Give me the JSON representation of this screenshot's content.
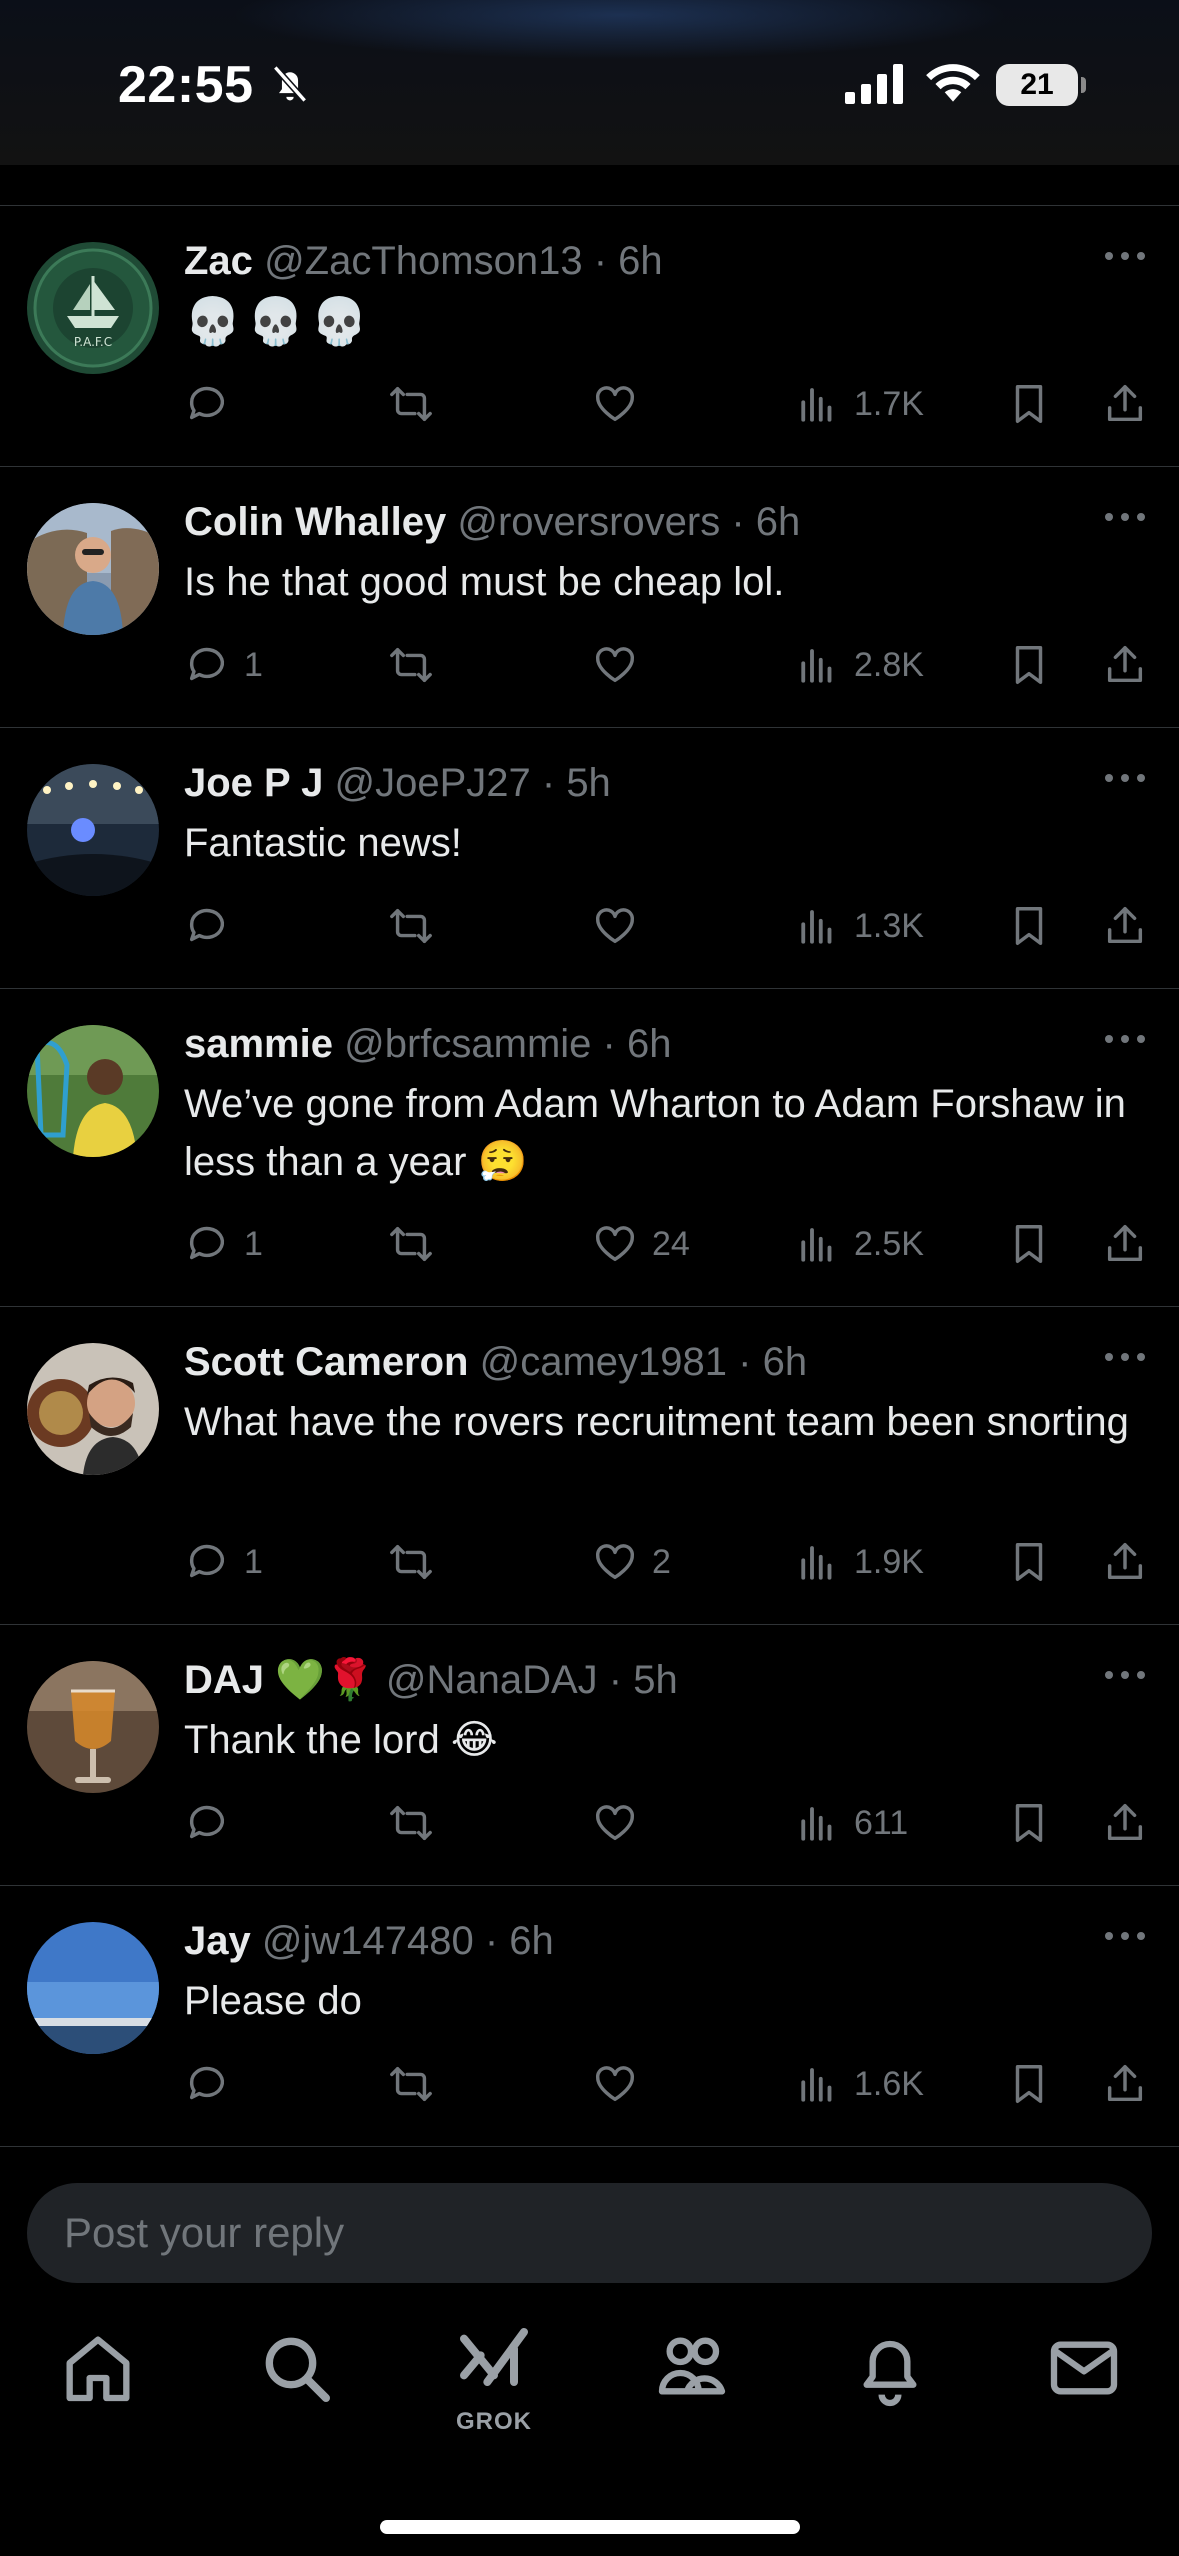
{
  "status_bar": {
    "time": "22:55",
    "battery": "21"
  },
  "composer": {
    "placeholder": "Post your reply"
  },
  "tabs": {
    "grok_label": "GROK"
  },
  "replies": [
    {
      "name": "Zac",
      "handle": "@ZacThomson13",
      "time": "6h",
      "text": "💀💀💀",
      "replies": "",
      "likes": "",
      "views": "1.7K",
      "avatar": "green crest"
    },
    {
      "name": "Colin Whalley",
      "handle": "@roversrovers",
      "time": "6h",
      "text": "Is he that good must be cheap lol.",
      "replies": "1",
      "likes": "",
      "views": "2.8K",
      "avatar": "man at colosseum"
    },
    {
      "name": "Joe P J",
      "handle": "@JoePJ27",
      "time": "5h",
      "text": "Fantastic news!",
      "replies": "",
      "likes": "",
      "views": "1.3K",
      "avatar": "stadium lights"
    },
    {
      "name": "sammie",
      "handle": "@brfcsammie",
      "time": "6h",
      "text": "We’ve gone from Adam Wharton to Adam Forshaw in less than a year 😮‍💨",
      "replies": "1",
      "likes": "24",
      "views": "2.5K",
      "avatar": "person with net"
    },
    {
      "name": "Scott Cameron",
      "handle": "@camey1981",
      "time": "6h",
      "text": "What have the rovers recruitment team been snorting",
      "replies": "1",
      "likes": "2",
      "views": "1.9K",
      "avatar": "man with trophy shield"
    },
    {
      "name": "DAJ 💚🌹",
      "handle": "@NanaDAJ",
      "time": "5h",
      "text": "Thank the lord 😂",
      "replies": "",
      "likes": "",
      "views": "611",
      "avatar": "glass of drink"
    },
    {
      "name": "Jay",
      "handle": "@jw147480",
      "time": "6h",
      "text": "Please do",
      "replies": "",
      "likes": "",
      "views": "1.6K",
      "avatar": "blue sky harbour"
    }
  ]
}
